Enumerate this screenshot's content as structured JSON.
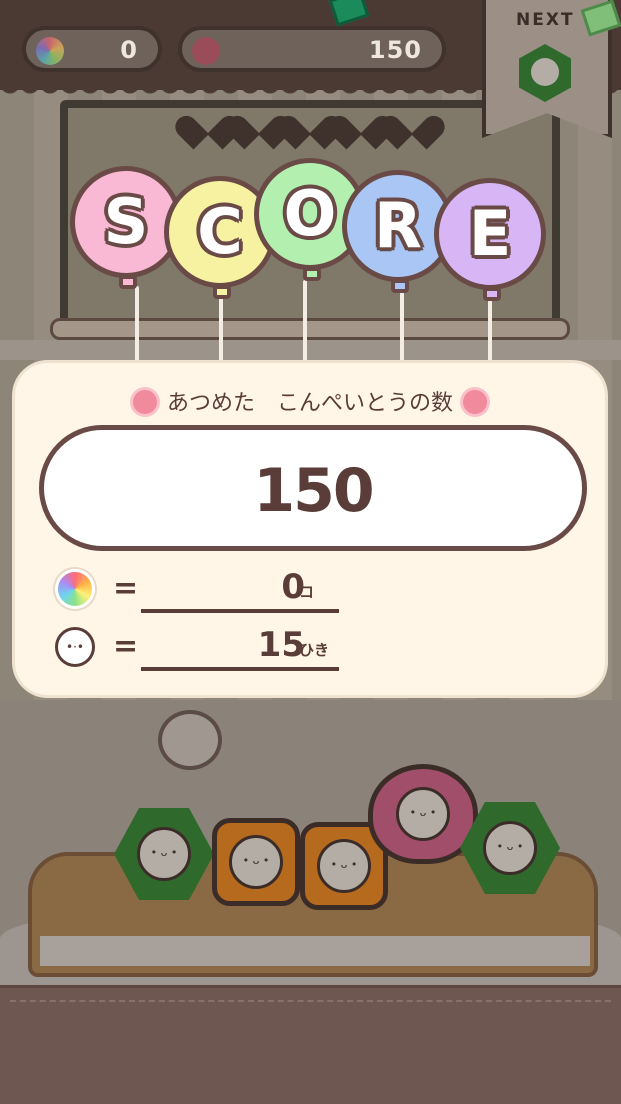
{
  "hud": {
    "rainbow_count": "0",
    "score": "150",
    "lives": 5,
    "next_label": "NEXT"
  },
  "score_title": {
    "letters": [
      "S",
      "C",
      "O",
      "R",
      "E"
    ],
    "balloon_colors": [
      "#f9b8d3",
      "#f6f2a2",
      "#b3f0b0",
      "#a9c6f5",
      "#d8b6f5"
    ]
  },
  "result": {
    "caption": "あつめた　こんぺいとうの数",
    "total": "150",
    "rainbow_value": "0",
    "rainbow_unit": "コ",
    "creature_value": "15",
    "creature_unit": "ひき",
    "equals": "="
  },
  "colors": {
    "panel_bg": "#fff6e8",
    "outline": "#6a4a46",
    "text": "#5a3d38"
  }
}
